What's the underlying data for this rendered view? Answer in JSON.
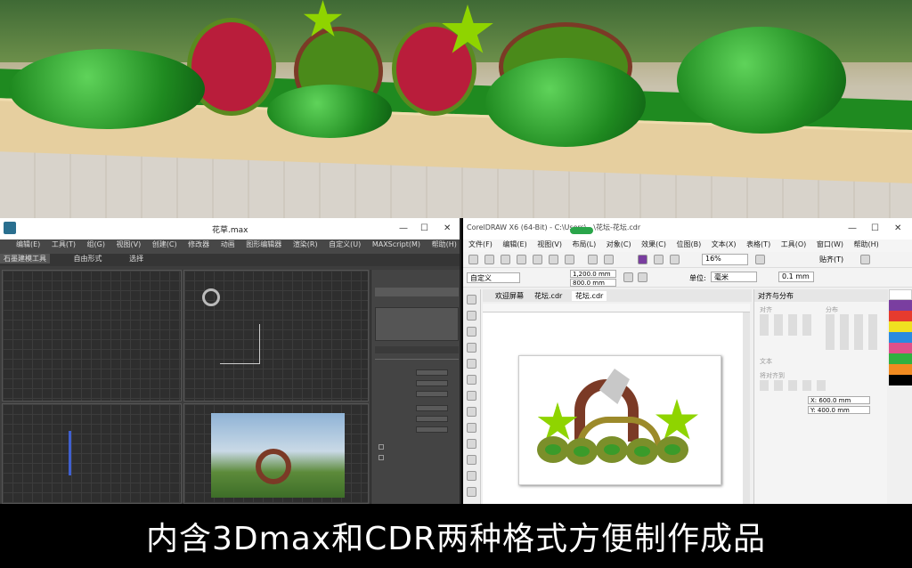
{
  "caption": "内含3Dmax和CDR两种格式方便制作成品",
  "max": {
    "title": "花草.max",
    "menus": [
      "编辑(E)",
      "工具(T)",
      "组(G)",
      "视图(V)",
      "创建(C)",
      "修改器",
      "动画",
      "图形编辑器",
      "渲染(R)",
      "自定义(U)",
      "MAXScript(M)",
      "帮助(H)"
    ],
    "ribbon": [
      "石墨建模工具",
      "自由形式",
      "选择"
    ],
    "window_buttons": [
      "—",
      "☐",
      "✕"
    ]
  },
  "cdr": {
    "title": "CorelDRAW X6 (64-Bit) - C:\\Users\\...\\花坛-花坛.cdr",
    "menus": [
      "文件(F)",
      "编辑(E)",
      "视图(V)",
      "布局(L)",
      "对象(C)",
      "效果(C)",
      "位图(B)",
      "文本(X)",
      "表格(T)",
      "工具(O)",
      "窗口(W)",
      "帮助(H)"
    ],
    "zoom": "16%",
    "paste": "贴齐(T)",
    "preset": "自定义",
    "width_mm": "1,200.0 mm",
    "height_mm": "800.0 mm",
    "unit_label": "单位:",
    "unit": "毫米",
    "nudge": "0.1 mm",
    "tabs": [
      "欢迎屏幕",
      "花坛.cdr",
      "花坛.cdr"
    ],
    "docker_title": "对齐与分布",
    "docker_sections": [
      "对齐",
      "分布",
      "文本",
      "将对齐到"
    ],
    "xy": [
      "X: 600.0 mm",
      "Y: 400.0 mm"
    ],
    "window_buttons": [
      "—",
      "☐",
      "✕"
    ]
  },
  "colors": {
    "accent_green": "#8fd400",
    "flower_brown": "#7b3a26",
    "render_grass": "#1f8a20"
  }
}
